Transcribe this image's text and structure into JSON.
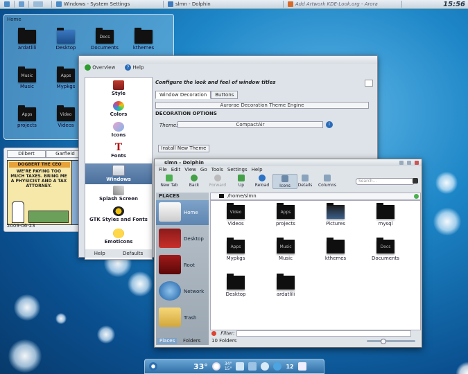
{
  "taskbar": {
    "items": [
      {
        "label": "Windows - System Settings"
      },
      {
        "label": "slmn - Dolphin"
      },
      {
        "label": "Add Artwork KDE-Look.org - Arora"
      }
    ],
    "clock": "15:56"
  },
  "folder_view": {
    "title": "Home",
    "items": [
      {
        "label": "ardatlili",
        "tag": ""
      },
      {
        "label": "Desktop",
        "tag": ""
      },
      {
        "label": "Documents",
        "tag": "Docs"
      },
      {
        "label": "kthemes",
        "tag": ""
      },
      {
        "label": "Music",
        "tag": "Music"
      },
      {
        "label": "Mypkgs",
        "tag": "Apps"
      },
      {
        "label": "projects",
        "tag": "Apps"
      },
      {
        "label": "Videos",
        "tag": "Video"
      }
    ]
  },
  "comic": {
    "tabs": [
      "Dilbert",
      "Garfield"
    ],
    "caption_top": "DOGBERT THE CEO",
    "speech": "WE'RE PAYING TOO MUCH TAXES. BRING ME A PHYSICIST AND A TAX ATTORNEY.",
    "date": "2009-06-23"
  },
  "settings": {
    "toolbar": {
      "overview": "Overview",
      "help": "Help"
    },
    "sidebar": [
      {
        "label": "Style"
      },
      {
        "label": "Colors"
      },
      {
        "label": "Icons"
      },
      {
        "label": "Fonts"
      },
      {
        "label": "Windows"
      },
      {
        "label": "Splash Screen"
      },
      {
        "label": "GTK Styles and Fonts"
      },
      {
        "label": "Emoticons"
      }
    ],
    "bottom_buttons": {
      "help": "Help",
      "defaults": "Defaults"
    },
    "heading": "Configure the look and feel of window titles",
    "tabs": [
      "Window Decoration",
      "Buttons"
    ],
    "engine": "Aurorae Decoration Theme Engine",
    "section": "DECORATION OPTIONS",
    "theme_label": "Theme:",
    "theme_value": "CompactAir",
    "install_button": "Install New Theme"
  },
  "dolphin": {
    "title": "slmn - Dolphin",
    "menu": [
      "File",
      "Edit",
      "View",
      "Go",
      "Tools",
      "Settings",
      "Help"
    ],
    "toolbar": [
      "New Tab",
      "Back",
      "Forward",
      "Up",
      "Reload",
      "Icons",
      "Details",
      "Columns"
    ],
    "search_placeholder": "Search...",
    "places_title": "PLACES",
    "places": [
      {
        "label": "Home"
      },
      {
        "label": "Desktop"
      },
      {
        "label": "Root"
      },
      {
        "label": "Network"
      },
      {
        "label": "Trash"
      }
    ],
    "path": "/home/slmn",
    "files": [
      {
        "label": "Videos",
        "tag": "Video"
      },
      {
        "label": "projects",
        "tag": "Apps"
      },
      {
        "label": "Pictures",
        "tag": ""
      },
      {
        "label": "mysql",
        "tag": ""
      },
      {
        "label": "Mypkgs",
        "tag": "Apps"
      },
      {
        "label": "Music",
        "tag": "Music"
      },
      {
        "label": "kthemes",
        "tag": ""
      },
      {
        "label": "Documents",
        "tag": "Docs"
      },
      {
        "label": "Desktop",
        "tag": ""
      },
      {
        "label": "ardatlili",
        "tag": ""
      }
    ],
    "filter_label": "Filter:",
    "status": "10 Folders",
    "panel_tabs": [
      "Places",
      "Folders"
    ]
  },
  "bottom_panel": {
    "temp": "33°",
    "high": "34°",
    "low": "15°",
    "tray_count": "12"
  }
}
